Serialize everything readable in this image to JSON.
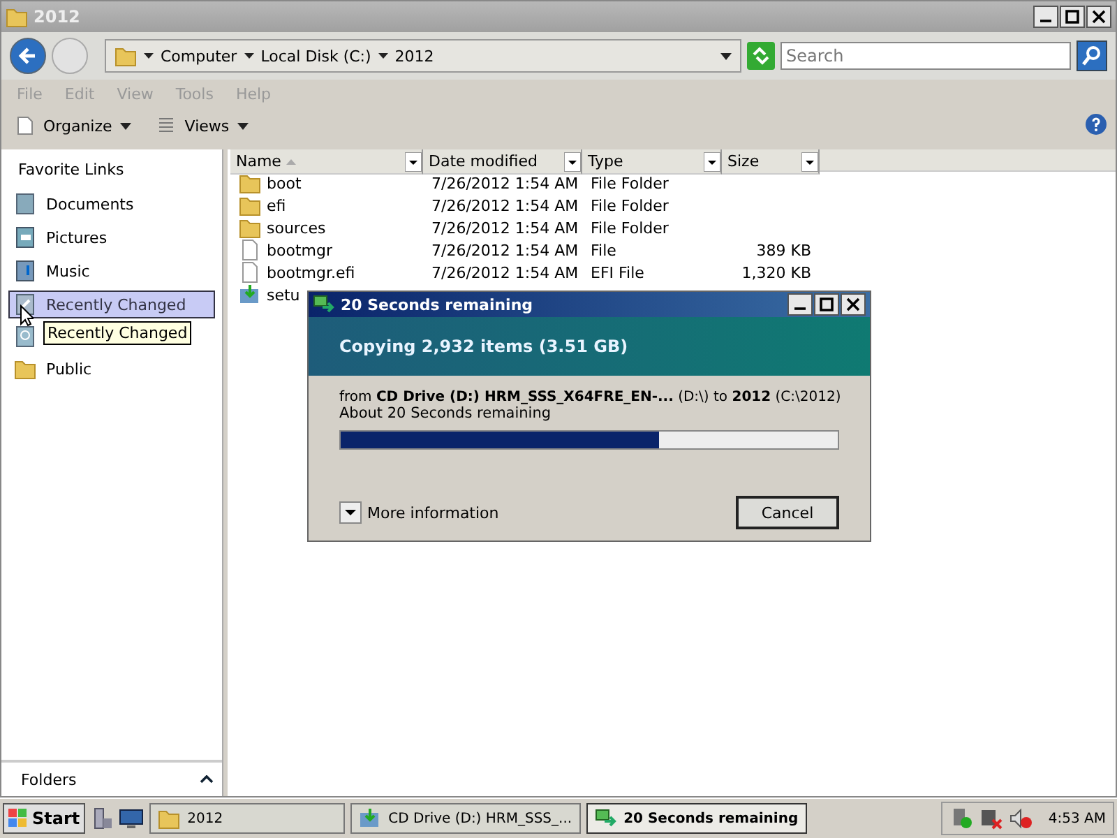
{
  "window": {
    "title": "2012"
  },
  "address": {
    "crumbs": [
      "Computer",
      "Local Disk (C:)",
      "2012"
    ],
    "search": {
      "placeholder": "Search"
    }
  },
  "menu": [
    "File",
    "Edit",
    "View",
    "Tools",
    "Help"
  ],
  "toolbar": [
    "Organize",
    "Views"
  ],
  "sidebar": {
    "title": "Favorite Links",
    "items": [
      {
        "label": "Documents",
        "selected": false
      },
      {
        "label": "Pictures",
        "selected": false
      },
      {
        "label": "Music",
        "selected": false
      },
      {
        "label": "Recently Changed",
        "selected": true
      },
      {
        "label": "Public",
        "selected": false
      }
    ],
    "tooltip": "Recently Changed",
    "folders": "Folders"
  },
  "table": {
    "columns": [
      "Name",
      "Date modified",
      "Type",
      "Size"
    ],
    "rows": [
      {
        "kind": "folder",
        "cells": [
          "boot",
          "7/26/2012 1:54 AM",
          "File Folder",
          ""
        ]
      },
      {
        "kind": "folder",
        "cells": [
          "efi",
          "7/26/2012 1:54 AM",
          "File Folder",
          ""
        ]
      },
      {
        "kind": "folder",
        "cells": [
          "sources",
          "7/26/2012 1:54 AM",
          "File Folder",
          ""
        ]
      },
      {
        "kind": "file",
        "cells": [
          "bootmgr",
          "7/26/2012 1:54 AM",
          "File",
          "389 KB"
        ]
      },
      {
        "kind": "file",
        "cells": [
          "bootmgr.efi",
          "7/26/2012 1:54 AM",
          "EFI File",
          "1,320 KB"
        ]
      },
      {
        "kind": "setup",
        "cells": [
          "setu"
        ]
      }
    ]
  },
  "dialog": {
    "title": "20 Seconds remaining",
    "heading": "Copying 2,932 items (3.51 GB)",
    "from": "from **CD Drive (D:) HRM_SSS_X64FRE_EN-...**  (D:\\) to **2012** (C:\\2012)",
    "time": "About 20 Seconds remaining",
    "level": 0.64,
    "more": "More information",
    "cancel": "Cancel"
  },
  "taskbar": {
    "start": "Start",
    "tasks": [
      {
        "label": "2012",
        "kind": "folder",
        "selected": false
      },
      {
        "label": "CD Drive (D:) HRM_SSS_...",
        "kind": "setup",
        "selected": false
      },
      {
        "label": "20 Seconds remaining",
        "kind": "copy",
        "selected": true
      }
    ],
    "clock": "4:53 AM"
  }
}
